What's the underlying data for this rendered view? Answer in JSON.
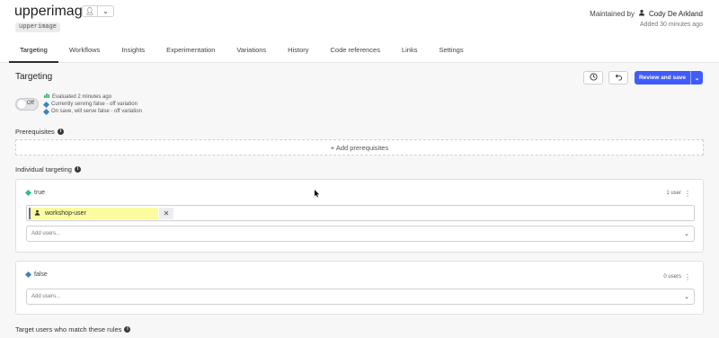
{
  "flag": {
    "name": "upperimage",
    "key": "upperimage",
    "maintained_by_label": "Maintained by",
    "maintainer": "Cody De Arkland",
    "added": "Added 30 minutes ago"
  },
  "tabs": [
    {
      "label": "Targeting",
      "active": true
    },
    {
      "label": "Workflows"
    },
    {
      "label": "Insights"
    },
    {
      "label": "Experimentation"
    },
    {
      "label": "Variations"
    },
    {
      "label": "History"
    },
    {
      "label": "Code references"
    },
    {
      "label": "Links"
    },
    {
      "label": "Settings"
    }
  ],
  "section": {
    "title": "Targeting",
    "review_label": "Review and save"
  },
  "toggle": {
    "state": "Off",
    "status": [
      {
        "text": "Evaluated 2 minutes ago",
        "icon": "bar-chart-icon",
        "color": "#27ae60"
      },
      {
        "text": "Currently serving false - off variation",
        "icon": "diamond-icon",
        "color": "#3b82c4"
      },
      {
        "text": "On save, will serve false - off variation",
        "icon": "diamond-icon",
        "color": "#3b82c4"
      }
    ]
  },
  "prerequisites": {
    "label": "Prerequisites",
    "add_label": "+ Add prerequisites"
  },
  "individual": {
    "label": "Individual targeting",
    "variations": [
      {
        "name": "true",
        "color": "#27c48a",
        "count": "1 user",
        "users": [
          "workshop-user"
        ],
        "placeholder": "Add users..."
      },
      {
        "name": "false",
        "color": "#3b82c4",
        "count": "0 users",
        "users": [],
        "placeholder": "Add users..."
      }
    ]
  },
  "rules": {
    "label": "Target users who match these rules"
  }
}
